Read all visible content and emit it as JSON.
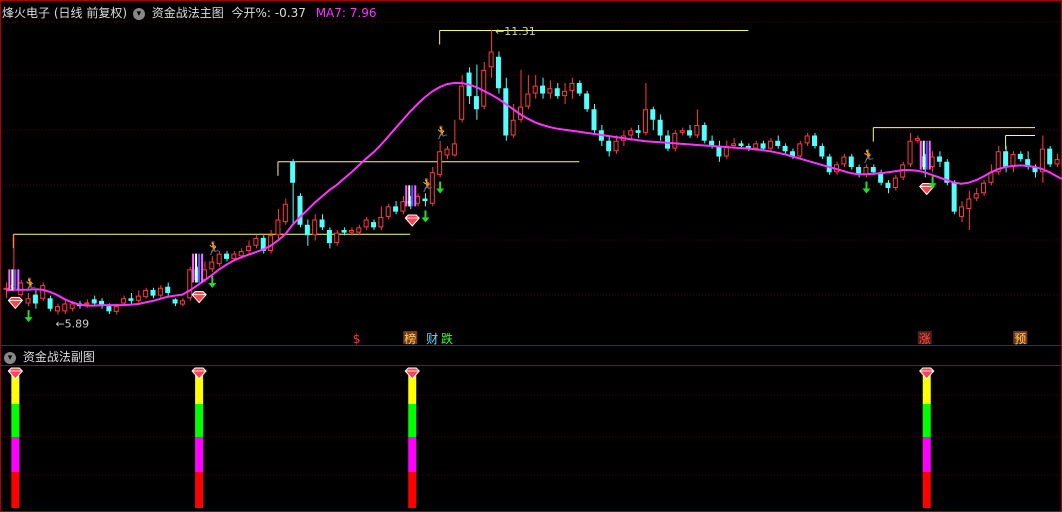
{
  "main_header": {
    "stock": "烽火电子",
    "period": "(日线 前复权)",
    "indicator": "资金战法主图",
    "open_label": "今开%:",
    "open_value": "-0.37",
    "ma_label": "MA7:",
    "ma_value": "7.96"
  },
  "sub_header": {
    "indicator": "资金战法副图"
  },
  "colors": {
    "up": "#ff3c3c",
    "down": "#54ffff",
    "ma": "#ff33ff",
    "grid": "#550000",
    "ref_line": "#ffff66",
    "header_red": "#ff4040",
    "ma_text": "#ff33ff"
  },
  "chart_data": {
    "type": "candlestick",
    "y_range": [
      5.5,
      11.5
    ],
    "high_label": "11.31",
    "low_label": "5.89",
    "candles": [
      [
        6.4,
        6.4,
        6.2,
        6.5
      ],
      [
        6.4,
        6.45,
        6.33,
        7.42
      ],
      [
        6.26,
        6.5,
        6.23,
        6.55
      ],
      [
        6.1,
        6.2,
        6.05,
        6.3
      ],
      [
        6.27,
        6.1,
        6.0,
        6.35
      ],
      [
        6.19,
        6.45,
        6.15,
        6.5
      ],
      [
        6.2,
        6.0,
        5.95,
        6.25
      ],
      [
        5.95,
        6.05,
        5.89,
        6.1
      ],
      [
        5.95,
        6.1,
        5.9,
        6.15
      ],
      [
        6.0,
        6.1,
        5.95,
        6.15
      ],
      [
        6.1,
        6.05,
        6.0,
        6.15
      ],
      [
        6.08,
        6.12,
        6.02,
        6.18
      ],
      [
        6.18,
        6.1,
        6.05,
        6.25
      ],
      [
        6.15,
        6.05,
        6.0,
        6.2
      ],
      [
        6.05,
        5.95,
        5.9,
        6.1
      ],
      [
        5.94,
        6.05,
        5.89,
        6.1
      ],
      [
        6.1,
        6.2,
        6.05,
        6.25
      ],
      [
        6.2,
        6.15,
        6.1,
        6.3
      ],
      [
        6.15,
        6.25,
        6.1,
        6.35
      ],
      [
        6.22,
        6.36,
        6.2,
        6.4
      ],
      [
        6.36,
        6.25,
        6.2,
        6.4
      ],
      [
        6.25,
        6.4,
        6.2,
        6.45
      ],
      [
        6.42,
        6.3,
        6.25,
        6.5
      ],
      [
        6.18,
        6.1,
        6.05,
        6.2
      ],
      [
        6.08,
        6.16,
        6.05,
        6.2
      ],
      [
        6.2,
        6.75,
        6.15,
        6.8
      ],
      [
        6.75,
        6.55,
        6.5,
        6.8
      ],
      [
        6.55,
        6.75,
        6.5,
        6.9
      ],
      [
        6.75,
        6.9,
        6.7,
        7.0
      ],
      [
        6.85,
        7.05,
        6.8,
        7.1
      ],
      [
        7.05,
        6.95,
        6.9,
        7.1
      ],
      [
        6.95,
        7.05,
        6.9,
        7.1
      ],
      [
        7.0,
        7.1,
        6.95,
        7.15
      ],
      [
        7.1,
        7.2,
        7.05,
        7.3
      ],
      [
        7.2,
        7.35,
        7.15,
        7.4
      ],
      [
        7.35,
        7.1,
        7.05,
        7.4
      ],
      [
        7.1,
        7.4,
        7.05,
        7.5
      ],
      [
        7.4,
        7.7,
        7.3,
        7.9
      ],
      [
        7.65,
        8.0,
        7.6,
        8.1
      ],
      [
        8.8,
        8.4,
        7.6,
        8.85
      ],
      [
        8.15,
        7.6,
        7.55,
        8.2
      ],
      [
        7.6,
        7.4,
        7.2,
        7.7
      ],
      [
        7.4,
        7.7,
        7.3,
        7.8
      ],
      [
        7.7,
        7.55,
        7.5,
        7.8
      ],
      [
        7.5,
        7.25,
        7.15,
        7.55
      ],
      [
        7.25,
        7.45,
        7.2,
        7.5
      ],
      [
        7.5,
        7.45,
        7.4,
        7.55
      ],
      [
        7.45,
        7.5,
        7.4,
        7.55
      ],
      [
        7.45,
        7.55,
        7.4,
        7.6
      ],
      [
        7.55,
        7.7,
        7.5,
        7.75
      ],
      [
        7.65,
        7.55,
        7.5,
        7.7
      ],
      [
        7.55,
        7.75,
        7.5,
        7.95
      ],
      [
        7.75,
        7.95,
        7.7,
        8.0
      ],
      [
        7.95,
        7.85,
        7.8,
        8.05
      ],
      [
        7.85,
        8.05,
        7.8,
        8.15
      ],
      [
        8.05,
        8.0,
        7.9,
        8.15
      ],
      [
        8.0,
        8.15,
        7.95,
        8.2
      ],
      [
        8.1,
        8.05,
        7.95,
        8.2
      ],
      [
        8.0,
        8.6,
        7.95,
        8.7
      ],
      [
        8.55,
        9.0,
        8.5,
        9.2
      ],
      [
        8.92,
        9.05,
        8.85,
        9.1
      ],
      [
        8.92,
        9.15,
        8.9,
        9.6
      ],
      [
        9.6,
        10.25,
        9.55,
        10.45
      ],
      [
        10.5,
        10.05,
        9.9,
        10.6
      ],
      [
        10.05,
        9.8,
        9.6,
        10.65
      ],
      [
        9.85,
        10.55,
        9.8,
        10.7
      ],
      [
        10.6,
        10.9,
        10.4,
        11.31
      ],
      [
        10.8,
        10.2,
        10.1,
        10.9
      ],
      [
        10.2,
        9.3,
        9.2,
        10.4
      ],
      [
        9.3,
        9.6,
        9.25,
        9.9
      ],
      [
        9.6,
        9.85,
        9.55,
        10.55
      ],
      [
        9.85,
        10.1,
        9.8,
        10.45
      ],
      [
        10.1,
        10.25,
        10.0,
        10.45
      ],
      [
        10.25,
        10.1,
        10.0,
        10.4
      ],
      [
        10.1,
        10.2,
        10.0,
        10.35
      ],
      [
        10.2,
        10.05,
        10.0,
        10.3
      ],
      [
        10.05,
        10.15,
        9.9,
        10.3
      ],
      [
        10.15,
        10.3,
        10.0,
        10.4
      ],
      [
        10.3,
        10.1,
        10.05,
        10.35
      ],
      [
        10.1,
        9.8,
        9.75,
        10.15
      ],
      [
        9.8,
        9.4,
        9.35,
        9.9
      ],
      [
        9.4,
        9.2,
        9.1,
        9.5
      ],
      [
        9.2,
        9.0,
        8.9,
        9.3
      ],
      [
        9.0,
        9.2,
        8.95,
        9.3
      ],
      [
        9.2,
        9.3,
        9.1,
        9.4
      ],
      [
        9.3,
        9.4,
        9.2,
        9.45
      ],
      [
        9.4,
        9.35,
        9.25,
        9.5
      ],
      [
        9.35,
        9.8,
        9.3,
        10.3
      ],
      [
        9.8,
        9.6,
        9.4,
        9.85
      ],
      [
        9.6,
        9.3,
        9.2,
        9.7
      ],
      [
        9.3,
        9.05,
        9.0,
        9.4
      ],
      [
        9.05,
        9.35,
        9.0,
        9.4
      ],
      [
        9.35,
        9.4,
        9.3,
        9.45
      ],
      [
        9.4,
        9.3,
        9.25,
        9.5
      ],
      [
        9.3,
        9.5,
        9.25,
        9.8
      ],
      [
        9.5,
        9.2,
        9.15,
        9.55
      ],
      [
        9.2,
        9.1,
        9.05,
        9.3
      ],
      [
        9.1,
        8.9,
        8.8,
        9.2
      ],
      [
        8.9,
        9.1,
        8.85,
        9.2
      ],
      [
        9.1,
        9.15,
        9.05,
        9.25
      ],
      [
        9.15,
        9.1,
        9.05,
        9.2
      ],
      [
        9.1,
        9.05,
        9.0,
        9.15
      ],
      [
        9.05,
        9.15,
        9.0,
        9.2
      ],
      [
        9.15,
        9.05,
        9.0,
        9.2
      ],
      [
        9.05,
        9.2,
        9.0,
        9.25
      ],
      [
        9.2,
        9.1,
        9.05,
        9.3
      ],
      [
        9.1,
        9.0,
        8.95,
        9.15
      ],
      [
        9.0,
        8.9,
        8.85,
        9.05
      ],
      [
        8.9,
        9.15,
        8.85,
        9.2
      ],
      [
        9.15,
        9.3,
        9.1,
        9.35
      ],
      [
        9.3,
        9.1,
        9.05,
        9.35
      ],
      [
        9.1,
        8.9,
        8.85,
        9.15
      ],
      [
        8.9,
        8.6,
        8.55,
        8.95
      ],
      [
        8.6,
        8.75,
        8.55,
        8.8
      ],
      [
        8.75,
        8.9,
        8.7,
        8.95
      ],
      [
        8.9,
        8.7,
        8.65,
        8.95
      ],
      [
        8.7,
        8.55,
        8.5,
        8.75
      ],
      [
        8.55,
        8.7,
        8.5,
        8.75
      ],
      [
        8.7,
        8.6,
        8.55,
        8.75
      ],
      [
        8.6,
        8.4,
        8.35,
        8.65
      ],
      [
        8.4,
        8.3,
        8.2,
        8.45
      ],
      [
        8.3,
        8.5,
        8.25,
        8.55
      ],
      [
        8.5,
        8.75,
        8.45,
        8.8
      ],
      [
        8.75,
        9.2,
        8.7,
        9.35
      ],
      [
        9.2,
        9.25,
        9.15,
        9.3
      ],
      [
        8.9,
        8.7,
        8.5,
        8.95
      ],
      [
        8.7,
        8.9,
        8.6,
        9.0
      ],
      [
        8.9,
        8.8,
        8.7,
        9.0
      ],
      [
        8.8,
        8.4,
        8.35,
        8.85
      ],
      [
        8.4,
        7.85,
        7.8,
        8.45
      ],
      [
        7.75,
        7.95,
        7.65,
        8.05
      ],
      [
        7.9,
        8.1,
        7.5,
        8.25
      ],
      [
        8.1,
        8.2,
        8.05,
        8.3
      ],
      [
        8.2,
        8.4,
        8.15,
        8.45
      ],
      [
        8.4,
        8.6,
        8.35,
        8.75
      ],
      [
        8.6,
        9.0,
        8.55,
        9.1
      ],
      [
        9.0,
        8.7,
        8.6,
        9.1
      ],
      [
        8.7,
        8.95,
        8.6,
        9.0
      ],
      [
        8.95,
        8.85,
        8.8,
        9.0
      ],
      [
        8.85,
        8.7,
        8.65,
        9.0
      ],
      [
        8.7,
        8.6,
        8.5,
        8.75
      ],
      [
        8.6,
        9.05,
        8.4,
        9.3
      ],
      [
        9.05,
        8.75,
        8.7,
        9.1
      ],
      [
        8.75,
        8.85,
        8.7,
        8.95
      ],
      [
        8.85,
        8.7,
        8.65,
        8.9
      ],
      [
        8.7,
        8.55,
        8.5,
        8.75
      ],
      [
        8.55,
        8.45,
        8.4,
        8.6
      ],
      [
        8.45,
        8.2,
        8.15,
        8.5
      ],
      [
        8.2,
        8.1,
        7.95,
        8.25
      ],
      [
        8.1,
        8.0,
        7.95,
        8.15
      ],
      [
        8.0,
        8.15,
        7.95,
        8.2
      ],
      [
        8.15,
        8.1,
        8.05,
        8.2
      ],
      [
        8.1,
        8.0,
        7.95,
        8.15
      ],
      [
        8.0,
        8.2,
        7.95,
        8.25
      ],
      [
        8.2,
        8.25,
        8.15,
        8.3
      ]
    ],
    "ma7": [
      6.35,
      6.36,
      6.36,
      6.36,
      6.37,
      6.36,
      6.32,
      6.26,
      6.18,
      6.12,
      6.08,
      6.06,
      6.06,
      6.07,
      6.07,
      6.07,
      6.07,
      6.08,
      6.09,
      6.12,
      6.15,
      6.19,
      6.23,
      6.25,
      6.27,
      6.35,
      6.44,
      6.54,
      6.64,
      6.75,
      6.84,
      6.92,
      6.98,
      7.03,
      7.08,
      7.13,
      7.2,
      7.3,
      7.42,
      7.6,
      7.75,
      7.88,
      8.02,
      8.14,
      8.26,
      8.36,
      8.48,
      8.6,
      8.73,
      8.86,
      8.98,
      9.12,
      9.28,
      9.44,
      9.6,
      9.76,
      9.9,
      10.03,
      10.14,
      10.22,
      10.28,
      10.3,
      10.3,
      10.27,
      10.22,
      10.15,
      10.08,
      10.0,
      9.9,
      9.8,
      9.7,
      9.62,
      9.55,
      9.5,
      9.46,
      9.43,
      9.41,
      9.39,
      9.37,
      9.35,
      9.33,
      9.31,
      9.29,
      9.27,
      9.25,
      9.23,
      9.21,
      9.19,
      9.18,
      9.17,
      9.16,
      9.15,
      9.14,
      9.13,
      9.12,
      9.11,
      9.1,
      9.09,
      9.08,
      9.07,
      9.06,
      9.05,
      9.04,
      9.02,
      9.0,
      8.97,
      8.94,
      8.9,
      8.86,
      8.82,
      8.78,
      8.74,
      8.7,
      8.66,
      8.62,
      8.58,
      8.56,
      8.56,
      8.57,
      8.58,
      8.6,
      8.62,
      8.64,
      8.64,
      8.63,
      8.6,
      8.55,
      8.5,
      8.45,
      8.4,
      8.38,
      8.4,
      8.45,
      8.52,
      8.6,
      8.66,
      8.7,
      8.72,
      8.73,
      8.72,
      8.7,
      8.66,
      8.6,
      8.52,
      8.45,
      8.38,
      8.32,
      8.28,
      8.24,
      8.22,
      8.2
    ],
    "ref_lines": [
      {
        "from": 1,
        "to": 55,
        "value": 7.42
      },
      {
        "from": 37,
        "to": 78,
        "value": 8.8
      },
      {
        "from": 59,
        "to": 101,
        "value": 11.3
      },
      {
        "from": 118,
        "to": 140,
        "value": 9.45
      },
      {
        "from": 136,
        "to": 140,
        "value": 9.3
      }
    ],
    "diamonds": [
      1,
      26,
      55,
      125
    ],
    "pink_bars": [
      1,
      26,
      55,
      125
    ],
    "runners": [
      3,
      28,
      57,
      59,
      117
    ],
    "down_arrows": [
      3,
      28,
      57,
      59,
      117,
      126
    ],
    "markers": [
      {
        "i": 48,
        "text": "$",
        "color": "#ff3030",
        "bg": ""
      },
      {
        "i": 55,
        "text": "榜",
        "color": "#ffd060",
        "bg": "#7a3a10"
      },
      {
        "i": 58,
        "text": "财",
        "color": "#66ddff",
        "bg": ""
      },
      {
        "i": 60,
        "text": "跌",
        "color": "#33ff33",
        "bg": ""
      },
      {
        "i": 125,
        "text": "涨",
        "color": "#ff5050",
        "bg": "#5a1a10"
      },
      {
        "i": 138,
        "text": "预",
        "color": "#ffd060",
        "bg": "#7a3a10"
      }
    ],
    "sub_signals": [
      1,
      26,
      55,
      125
    ],
    "sub_colors": [
      "#ffff00",
      "#00ff00",
      "#ff00ff",
      "#ff0000"
    ]
  }
}
